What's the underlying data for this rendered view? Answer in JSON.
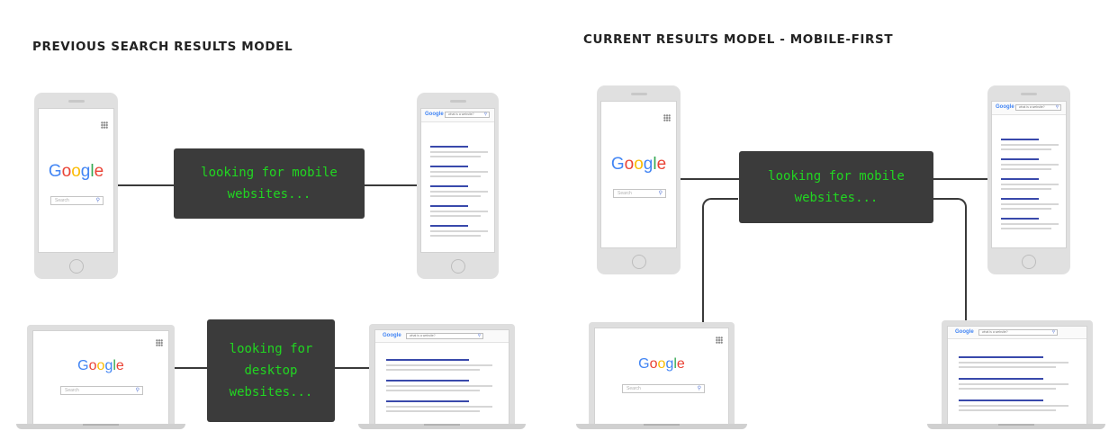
{
  "left_panel": {
    "heading": "PREVIOUS SEARCH RESULTS MODEL",
    "mobile_terminal_text": [
      "looking for mobile",
      "websites..."
    ],
    "desktop_terminal_text": [
      "looking for",
      "desktop",
      "websites..."
    ]
  },
  "right_panel": {
    "heading": "CURRENT RESULTS MODEL - MOBILE-FIRST",
    "terminal_text": [
      "looking for mobile",
      "websites..."
    ]
  },
  "google_home": {
    "logo_letters": [
      "G",
      "o",
      "o",
      "g",
      "l",
      "e"
    ],
    "logo_colors": [
      "#4285F4",
      "#EA4335",
      "#FBBC05",
      "#4285F4",
      "#34A853",
      "#EA4335"
    ],
    "search_placeholder": "Search",
    "apps_icon": "apps-grid-icon",
    "search_icon": "magnifier-icon"
  },
  "results_page": {
    "mini_logo": "Google",
    "query": "what is a website?"
  },
  "colors": {
    "terminal_bg": "#3b3b3b",
    "terminal_text": "#21d621",
    "result_link": "#3949ab",
    "result_snippet": "#d6d6d6",
    "device_body": "#e0e0e0",
    "connector": "#3a3a3a"
  }
}
